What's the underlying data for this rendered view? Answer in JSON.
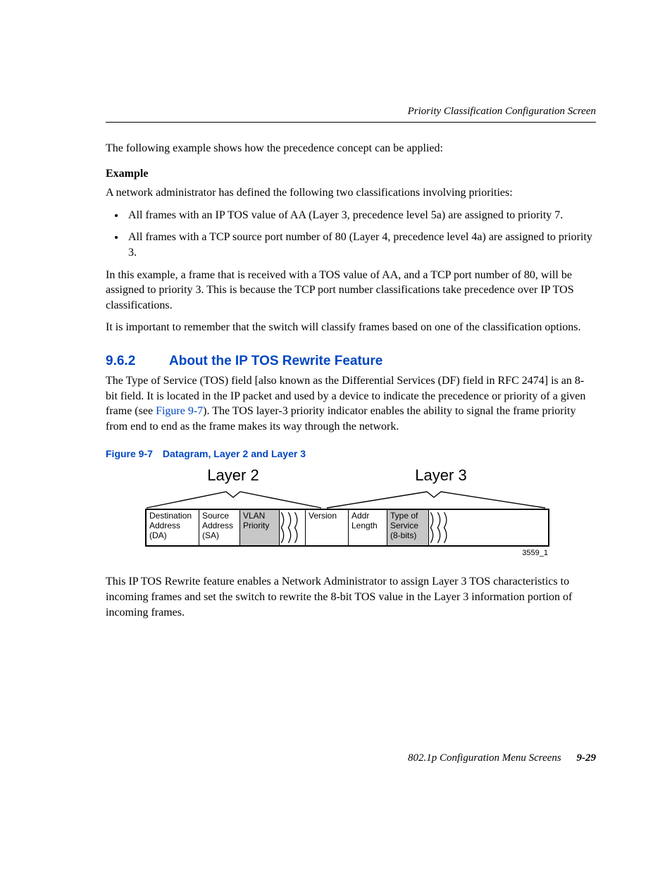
{
  "header": {
    "right": "Priority Classification Configuration Screen"
  },
  "intro": "The following example shows how the precedence concept can be applied:",
  "example_label": "Example",
  "example_intro": "A network administrator has defined the following two classifications involving priorities:",
  "bullets": [
    "All frames with an IP TOS value of AA (Layer 3, precedence level 5a) are assigned to priority 7.",
    "All frames with a TCP source port number of 80 (Layer 4, precedence level 4a) are assigned to priority 3."
  ],
  "example_para1": "In this example, a frame that is received with a TOS value of AA, and a TCP port number of 80, will be assigned to priority 3. This is because the TCP port number classifications take precedence over IP TOS classifications.",
  "example_para2": "It is important to remember that the switch will classify frames based on one of the classification options.",
  "section": {
    "number": "9.6.2",
    "title": "About the IP TOS Rewrite Feature"
  },
  "section_para_pre": "The Type of Service (TOS) field [also known as the Differential Services (DF) field in RFC 2474] is an 8-bit field. It is located in the IP packet and used by a device to indicate the precedence or priority of a given frame (see ",
  "section_link": "Figure 9-7",
  "section_para_post": "). The TOS layer-3 priority indicator enables the ability to signal the frame priority from end to end as the frame makes its way through the network.",
  "figure": {
    "caption_prefix": "Figure 9-7",
    "caption_title": "Datagram, Layer 2 and Layer 3",
    "layer2_label": "Layer 2",
    "layer3_label": "Layer 3",
    "boxes": {
      "da": "Destination\nAddress\n(DA)",
      "sa": "Source\nAddress\n(SA)",
      "vlan": "VLAN\nPriority",
      "version": "Version",
      "addr": "Addr\nLength",
      "tos": "Type of\nService\n(8-bits)"
    },
    "id": "3559_1"
  },
  "after_figure": "This IP TOS Rewrite feature enables a Network Administrator to assign Layer 3 TOS characteristics to incoming frames and set the switch to rewrite the 8-bit TOS value in the Layer 3 information portion of incoming frames.",
  "footer": {
    "text": "802.1p Configuration Menu Screens",
    "page": "9-29"
  }
}
